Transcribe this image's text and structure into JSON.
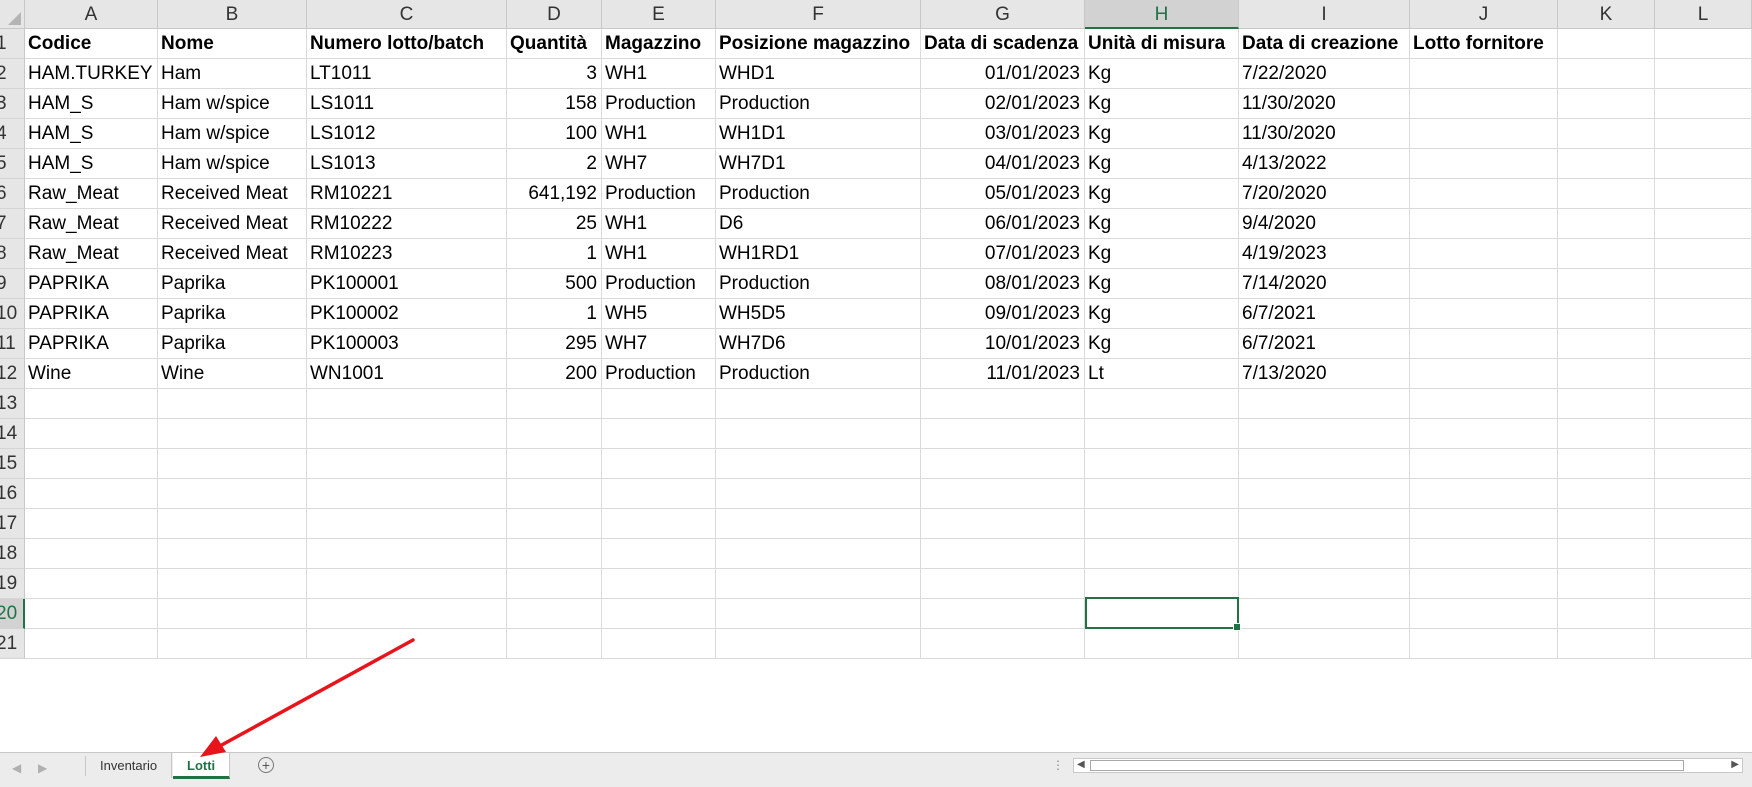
{
  "columns": [
    "A",
    "B",
    "C",
    "D",
    "E",
    "F",
    "G",
    "H",
    "I",
    "J",
    "K",
    "L"
  ],
  "selected_column": "H",
  "selected_row": "20",
  "row_numbers": [
    "1",
    "2",
    "3",
    "4",
    "5",
    "6",
    "7",
    "8",
    "9",
    "10",
    "11",
    "12",
    "13",
    "14",
    "15",
    "16",
    "17",
    "18",
    "19",
    "20",
    "21"
  ],
  "header_row": [
    "Codice",
    "Nome",
    "Numero lotto/batch",
    "Quantità",
    "Magazzino",
    "Posizione magazzino",
    "Data di scadenza",
    "Unità di misura",
    "Data di creazione",
    "Lotto fornitore",
    "",
    ""
  ],
  "rows": [
    [
      "HAM.TURKEY",
      "Ham",
      "LT1011",
      "3",
      "WH1",
      "WHD1",
      "01/01/2023",
      "Kg",
      "7/22/2020",
      "",
      "",
      ""
    ],
    [
      "HAM_S",
      "Ham w/spice",
      "LS1011",
      "158",
      "Production",
      "Production",
      "02/01/2023",
      "Kg",
      "11/30/2020",
      "",
      "",
      ""
    ],
    [
      "HAM_S",
      "Ham w/spice",
      "LS1012",
      "100",
      "WH1",
      "WH1D1",
      "03/01/2023",
      "Kg",
      "11/30/2020",
      "",
      "",
      ""
    ],
    [
      "HAM_S",
      "Ham w/spice",
      "LS1013",
      "2",
      "WH7",
      "WH7D1",
      "04/01/2023",
      "Kg",
      "4/13/2022",
      "",
      "",
      ""
    ],
    [
      "Raw_Meat",
      "Received Meat",
      "RM10221",
      "641,192",
      "Production",
      "Production",
      "05/01/2023",
      "Kg",
      "7/20/2020",
      "",
      "",
      ""
    ],
    [
      "Raw_Meat",
      "Received Meat",
      "RM10222",
      "25",
      "WH1",
      "D6",
      "06/01/2023",
      "Kg",
      "9/4/2020",
      "",
      "",
      ""
    ],
    [
      "Raw_Meat",
      "Received Meat",
      "RM10223",
      "1",
      "WH1",
      "WH1RD1",
      "07/01/2023",
      "Kg",
      "4/19/2023",
      "",
      "",
      ""
    ],
    [
      "PAPRIKA",
      "Paprika",
      "PK100001",
      "500",
      "Production",
      "Production",
      "08/01/2023",
      "Kg",
      "7/14/2020",
      "",
      "",
      ""
    ],
    [
      "PAPRIKA",
      "Paprika",
      "PK100002",
      "1",
      "WH5",
      "WH5D5",
      "09/01/2023",
      "Kg",
      "6/7/2021",
      "",
      "",
      ""
    ],
    [
      "PAPRIKA",
      "Paprika",
      "PK100003",
      "295",
      "WH7",
      "WH7D6",
      "10/01/2023",
      "Kg",
      "6/7/2021",
      "",
      "",
      ""
    ],
    [
      "Wine",
      "Wine",
      "WN1001",
      "200",
      "Production",
      "Production",
      "11/01/2023",
      "Lt",
      "7/13/2020",
      "",
      "",
      ""
    ]
  ],
  "sheet_tabs": [
    {
      "label": "Inventario",
      "active": false
    },
    {
      "label": "Lotti",
      "active": true
    }
  ],
  "colors": {
    "accent": "#217346",
    "arrow": "#e8141c"
  }
}
